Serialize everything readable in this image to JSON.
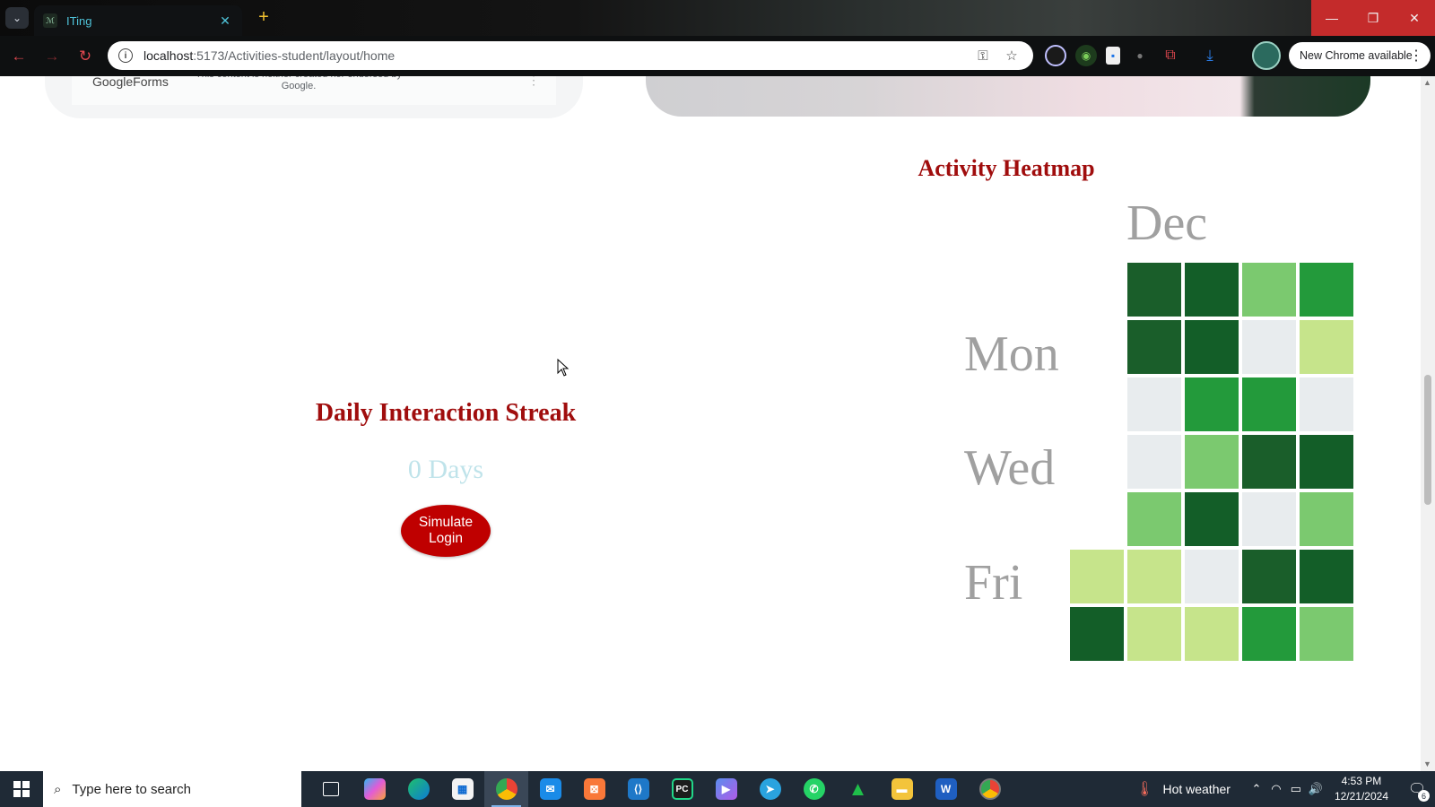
{
  "browser": {
    "tab": {
      "title": "ITing",
      "favicon": "iting-favicon"
    },
    "new_tab_glyph": "+",
    "url": {
      "host": "localhost",
      "path": ":5173/Activities-student/layout/home"
    },
    "update_chip": "New Chrome available",
    "window_controls": {
      "minimize": "—",
      "maximize": "❐",
      "close": "✕"
    },
    "colors": {
      "tab_title": "#4fc3d9",
      "accent_red": "#e0474f"
    }
  },
  "forms_embed": {
    "logo_google": "Google",
    "logo_forms": "Forms",
    "note": "This content is neither created nor endorsed by Google."
  },
  "heatmap": {
    "title": "Activity Heatmap",
    "month_label": "Dec",
    "day_labels": [
      "Mon",
      "Wed",
      "Fri"
    ],
    "colors": {
      "empty": "#e8ecee",
      "level1": "#c6e48b",
      "level2": "#7bc96f",
      "level3": "#239a3b",
      "level4": "#1a5e2a",
      "level5": "#135e28"
    },
    "grid": [
      [
        null,
        "level4",
        "level5",
        "level2",
        "level3"
      ],
      [
        null,
        "level4",
        "level5",
        "empty",
        "level1"
      ],
      [
        null,
        "empty",
        "level3",
        "level3",
        "empty"
      ],
      [
        null,
        "empty",
        "level2",
        "level4",
        "level5"
      ],
      [
        null,
        "level2",
        "level5",
        "empty",
        "level2"
      ],
      [
        "level1",
        "level1",
        "empty",
        "level4",
        "level5"
      ],
      [
        "level5",
        "level1",
        "level1",
        "level3",
        "level2"
      ]
    ],
    "title_color": "#a00d0d"
  },
  "streak": {
    "title": "Daily Interaction Streak",
    "days": "0 Days",
    "button_label": "Simulate Login"
  },
  "taskbar": {
    "search_placeholder": "Type here to search",
    "weather": "Hot weather",
    "time": "4:53 PM",
    "date": "12/21/2024",
    "notification_count": "6",
    "apps": [
      "task-view",
      "copilot",
      "edge",
      "store",
      "chrome",
      "mail",
      "app-orange",
      "vscode",
      "pycharm",
      "app-purple",
      "telegram",
      "whatsapp",
      "app-green",
      "file-explorer",
      "word",
      "chrome-profile"
    ]
  }
}
